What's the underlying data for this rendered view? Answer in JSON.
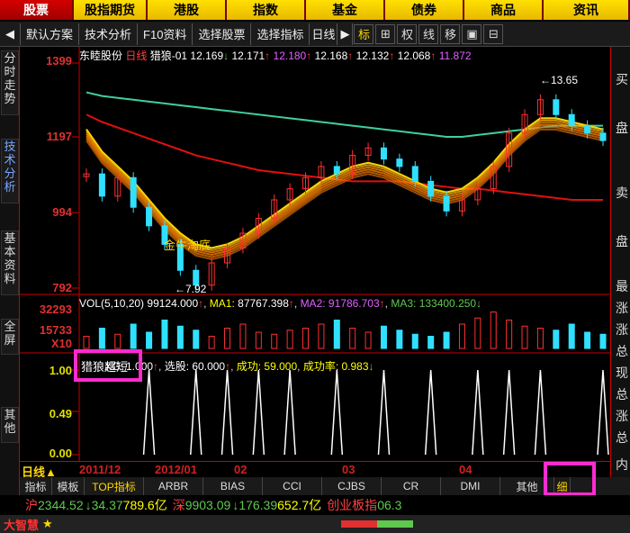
{
  "menu": [
    "股票",
    "股指期货",
    "港股",
    "指数",
    "基金",
    "债券",
    "商品",
    "资讯"
  ],
  "toolbar": {
    "items": [
      "默认方案",
      "技术分析",
      "F10资料",
      "选择股票",
      "选择指标",
      "日线"
    ],
    "icons": [
      "标",
      "⊞",
      "权",
      "线",
      "移",
      "▣",
      "⊟"
    ]
  },
  "left_tabs": [
    "分时走势",
    "技术分析",
    "基本资料",
    "全屏",
    "其他"
  ],
  "right_col": [
    "买",
    "盘",
    "卖",
    "盘",
    "最",
    "涨",
    "涨",
    "总",
    "现",
    "总",
    "涨",
    "总",
    "内"
  ],
  "price_chart": {
    "title": "东睦股份",
    "period": "日线",
    "indicator_name": "猎狼-01",
    "values": [
      "12.169",
      "12.171",
      "12.180",
      "12.168",
      "12.132",
      "12.068",
      "11.872"
    ],
    "y_ticks": [
      "1399",
      "1197",
      "994",
      "792"
    ],
    "annotation_high": "13.65",
    "annotation_low": "7.92",
    "annotation_text": "金牛淘底"
  },
  "volume_chart": {
    "legend_name": "VOL(5,10,20)",
    "vol": "99124.000",
    "ma1_label": "MA1:",
    "ma1": "87767.398",
    "ma2_label": "MA2:",
    "ma2": "91786.703",
    "ma3_label": "MA3:",
    "ma3": "133400.250",
    "y_ticks": [
      "32293",
      "15733",
      "X10"
    ]
  },
  "signal_chart": {
    "highlight_label": "猎狼超短",
    "legend_rest_a": "XG: 1.000",
    "legend_xuangu": "选股: 60.000",
    "legend_chenggong": "成功: 59.000",
    "legend_rate": "成功率: 0.983",
    "y_ticks": [
      "1.00",
      "0.49",
      "0.00"
    ]
  },
  "date_axis": {
    "period_label": "日线",
    "labels": [
      "2011/12",
      "2012/01",
      "02",
      "03",
      "04"
    ]
  },
  "indicator_tabs": [
    "指标",
    "模板",
    "TOP指标",
    "ARBR",
    "BIAS",
    "CCI",
    "CJBS",
    "CR",
    "DMI",
    "其他",
    "细"
  ],
  "index_bar": {
    "sh_label": "沪",
    "sh_value": "2344.52",
    "sh_change": "34.37",
    "sh_amount": "789.6亿",
    "sz_label": "深",
    "sz_value": "9903.09",
    "sz_change": "176.39",
    "sz_amount": "652.7亿",
    "cy_label": "创业板指",
    "cy_value": "06.3"
  },
  "status_bar": {
    "brand": "大智慧"
  },
  "colors": {
    "accent_red": "#e03030",
    "menu_yellow": "#ffe000",
    "highlight_pink": "#ff2bd0"
  },
  "chart_data": [
    {
      "type": "line",
      "title": "东睦股份 日线",
      "ylim": [
        7.92,
        13.99
      ],
      "series": [
        {
          "name": "price",
          "values": [
            11.0,
            10.4,
            10.9,
            10.1,
            9.6,
            9.1,
            8.4,
            8.0,
            8.6,
            9.0,
            9.4,
            9.8,
            10.3,
            10.6,
            10.9,
            11.2,
            11.0,
            11.5,
            11.7,
            11.4,
            11.2,
            10.8,
            10.4,
            10.0,
            10.3,
            10.6,
            11.2,
            12.1,
            12.6,
            13.0,
            12.6,
            12.3,
            12.1,
            11.9
          ]
        },
        {
          "name": "MA-green",
          "values": [
            13.2,
            13.1,
            13.05,
            13.0,
            12.95,
            12.9,
            12.85,
            12.8,
            12.75,
            12.7,
            12.65,
            12.6,
            12.55,
            12.5,
            12.45,
            12.4,
            12.35,
            12.3,
            12.25,
            12.2,
            12.15,
            12.1,
            12.05,
            12.0,
            12.0,
            12.05,
            12.1,
            12.15,
            12.2,
            12.25,
            12.3,
            12.3,
            12.3,
            12.3
          ]
        },
        {
          "name": "MA-red",
          "values": [
            12.6,
            12.4,
            12.25,
            12.1,
            11.95,
            11.8,
            11.65,
            11.5,
            11.4,
            11.3,
            11.2,
            11.1,
            11.05,
            11.0,
            10.95,
            10.9,
            10.85,
            10.8,
            10.8,
            10.8,
            10.8,
            10.75,
            10.7,
            10.65,
            10.6,
            10.6,
            10.55,
            10.5,
            10.45,
            10.4,
            10.35,
            10.3,
            10.3,
            10.3
          ]
        },
        {
          "name": "MA-yellow",
          "values": [
            12.2,
            11.6,
            11.2,
            10.8,
            10.3,
            9.8,
            9.4,
            9.1,
            9.0,
            9.1,
            9.3,
            9.6,
            9.9,
            10.2,
            10.5,
            10.8,
            11.0,
            11.2,
            11.3,
            11.2,
            11.0,
            10.8,
            10.6,
            10.5,
            10.6,
            10.9,
            11.3,
            11.8,
            12.2,
            12.5,
            12.5,
            12.4,
            12.3,
            12.2
          ]
        }
      ]
    },
    {
      "type": "line",
      "title": "猎狼超短",
      "ylim": [
        0,
        1
      ],
      "x": [
        4,
        7,
        9,
        11,
        13,
        16,
        19,
        22,
        25,
        27,
        29,
        33
      ],
      "values": [
        1,
        1,
        1,
        1,
        1,
        1,
        1,
        1,
        1,
        1,
        1,
        1
      ]
    }
  ]
}
